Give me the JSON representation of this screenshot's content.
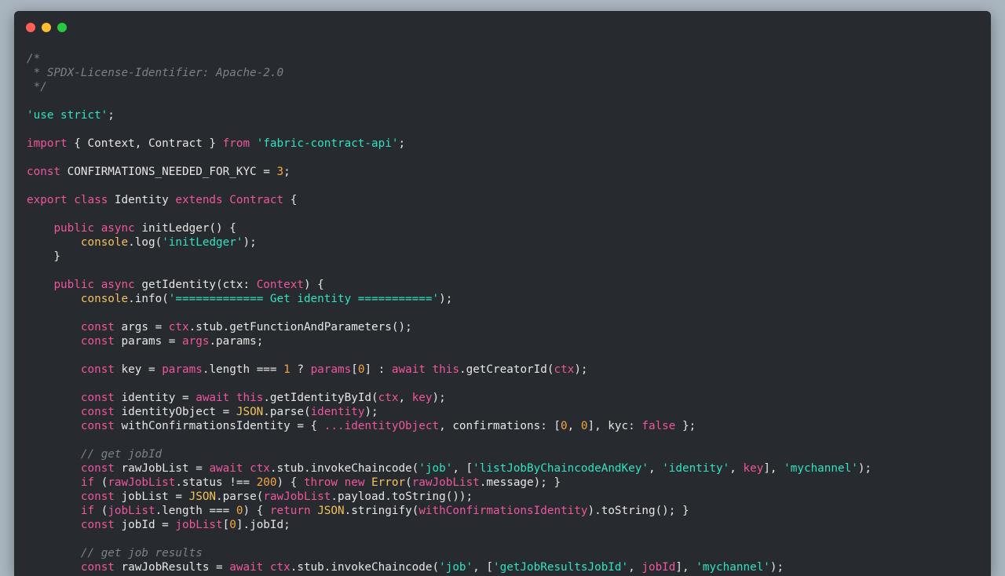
{
  "window": {
    "buttons": [
      {
        "name": "close",
        "color": "#ff5f57"
      },
      {
        "name": "minimize",
        "color": "#febc2e"
      },
      {
        "name": "maximize",
        "color": "#28c840"
      }
    ]
  },
  "theme": {
    "background": "#272a2f",
    "comment": "#7d8288",
    "keyword": "#f0569b",
    "string": "#2fe3c2",
    "number": "#f5a742",
    "builtin": "#f5c15a",
    "plain": "#e6e6e6"
  },
  "code": {
    "language": "typescript",
    "lines": [
      [
        [
          "cm",
          "/*"
        ]
      ],
      [
        [
          "cm",
          " * SPDX-License-Identifier: Apache-2.0"
        ]
      ],
      [
        [
          "cm",
          " */"
        ]
      ],
      [],
      [
        [
          "st",
          "'use strict'"
        ],
        [
          "pl",
          ";"
        ]
      ],
      [],
      [
        [
          "kw",
          "import"
        ],
        [
          "pl",
          " { Context, Contract } "
        ],
        [
          "kw",
          "from"
        ],
        [
          "pl",
          " "
        ],
        [
          "st",
          "'fabric-contract-api'"
        ],
        [
          "pl",
          ";"
        ]
      ],
      [],
      [
        [
          "kw",
          "const"
        ],
        [
          "pl",
          " CONFIRMATIONS_NEEDED_FOR_KYC = "
        ],
        [
          "nu",
          "3"
        ],
        [
          "pl",
          ";"
        ]
      ],
      [],
      [
        [
          "kw",
          "export"
        ],
        [
          "pl",
          " "
        ],
        [
          "kw",
          "class"
        ],
        [
          "pl",
          " Identity "
        ],
        [
          "kw",
          "extends"
        ],
        [
          "pl",
          " "
        ],
        [
          "kw",
          "Contract"
        ],
        [
          "pl",
          " {"
        ]
      ],
      [],
      [
        [
          "pl",
          "    "
        ],
        [
          "kw",
          "public"
        ],
        [
          "pl",
          " "
        ],
        [
          "kw",
          "async"
        ],
        [
          "pl",
          " initLedger() {"
        ]
      ],
      [
        [
          "pl",
          "        "
        ],
        [
          "bi",
          "console"
        ],
        [
          "pl",
          ".log("
        ],
        [
          "st",
          "'initLedger'"
        ],
        [
          "pl",
          ");"
        ]
      ],
      [
        [
          "pl",
          "    }"
        ]
      ],
      [],
      [
        [
          "pl",
          "    "
        ],
        [
          "kw",
          "public"
        ],
        [
          "pl",
          " "
        ],
        [
          "kw",
          "async"
        ],
        [
          "pl",
          " getIdentity(ctx: "
        ],
        [
          "kw",
          "Context"
        ],
        [
          "pl",
          ") {"
        ]
      ],
      [
        [
          "pl",
          "        "
        ],
        [
          "bi",
          "console"
        ],
        [
          "pl",
          ".info("
        ],
        [
          "st",
          "'============= Get identity ==========='"
        ],
        [
          "pl",
          ");"
        ]
      ],
      [],
      [
        [
          "pl",
          "        "
        ],
        [
          "kw",
          "const"
        ],
        [
          "pl",
          " args = "
        ],
        [
          "vr",
          "ctx"
        ],
        [
          "pl",
          ".stub.getFunctionAndParameters();"
        ]
      ],
      [
        [
          "pl",
          "        "
        ],
        [
          "kw",
          "const"
        ],
        [
          "pl",
          " params = "
        ],
        [
          "vr",
          "args"
        ],
        [
          "pl",
          ".params;"
        ]
      ],
      [],
      [
        [
          "pl",
          "        "
        ],
        [
          "kw",
          "const"
        ],
        [
          "pl",
          " key = "
        ],
        [
          "vr",
          "params"
        ],
        [
          "pl",
          ".length === "
        ],
        [
          "nu",
          "1"
        ],
        [
          "pl",
          " ? "
        ],
        [
          "vr",
          "params"
        ],
        [
          "pl",
          "["
        ],
        [
          "nu",
          "0"
        ],
        [
          "pl",
          "] : "
        ],
        [
          "kw",
          "await"
        ],
        [
          "pl",
          " "
        ],
        [
          "kw",
          "this"
        ],
        [
          "pl",
          ".getCreatorId("
        ],
        [
          "vr",
          "ctx"
        ],
        [
          "pl",
          ");"
        ]
      ],
      [],
      [
        [
          "pl",
          "        "
        ],
        [
          "kw",
          "const"
        ],
        [
          "pl",
          " identity = "
        ],
        [
          "kw",
          "await"
        ],
        [
          "pl",
          " "
        ],
        [
          "kw",
          "this"
        ],
        [
          "pl",
          ".getIdentityById("
        ],
        [
          "vr",
          "ctx"
        ],
        [
          "pl",
          ", "
        ],
        [
          "vr",
          "key"
        ],
        [
          "pl",
          ");"
        ]
      ],
      [
        [
          "pl",
          "        "
        ],
        [
          "kw",
          "const"
        ],
        [
          "pl",
          " identityObject = "
        ],
        [
          "bi",
          "JSON"
        ],
        [
          "pl",
          ".parse("
        ],
        [
          "vr",
          "identity"
        ],
        [
          "pl",
          ");"
        ]
      ],
      [
        [
          "pl",
          "        "
        ],
        [
          "kw",
          "const"
        ],
        [
          "pl",
          " withConfirmationsIdentity = { "
        ],
        [
          "vr",
          "..."
        ],
        [
          "vr",
          "identityObject"
        ],
        [
          "pl",
          ", confirmations: ["
        ],
        [
          "nu",
          "0"
        ],
        [
          "pl",
          ", "
        ],
        [
          "nu",
          "0"
        ],
        [
          "pl",
          "], kyc: "
        ],
        [
          "kw",
          "false"
        ],
        [
          "pl",
          " };"
        ]
      ],
      [],
      [
        [
          "pl",
          "        "
        ],
        [
          "cm",
          "// get jobId"
        ]
      ],
      [
        [
          "pl",
          "        "
        ],
        [
          "kw",
          "const"
        ],
        [
          "pl",
          " rawJobList = "
        ],
        [
          "kw",
          "await"
        ],
        [
          "pl",
          " "
        ],
        [
          "vr",
          "ctx"
        ],
        [
          "pl",
          ".stub.invokeChaincode("
        ],
        [
          "st",
          "'job'"
        ],
        [
          "pl",
          ", ["
        ],
        [
          "st",
          "'listJobByChaincodeAndKey'"
        ],
        [
          "pl",
          ", "
        ],
        [
          "st",
          "'identity'"
        ],
        [
          "pl",
          ", "
        ],
        [
          "vr",
          "key"
        ],
        [
          "pl",
          "], "
        ],
        [
          "st",
          "'mychannel'"
        ],
        [
          "pl",
          ");"
        ]
      ],
      [
        [
          "pl",
          "        "
        ],
        [
          "kw",
          "if"
        ],
        [
          "pl",
          " ("
        ],
        [
          "vr",
          "rawJobList"
        ],
        [
          "pl",
          ".status !== "
        ],
        [
          "nu",
          "200"
        ],
        [
          "pl",
          ") { "
        ],
        [
          "kw",
          "throw"
        ],
        [
          "pl",
          " "
        ],
        [
          "kw",
          "new"
        ],
        [
          "pl",
          " "
        ],
        [
          "bi",
          "Error"
        ],
        [
          "pl",
          "("
        ],
        [
          "vr",
          "rawJobList"
        ],
        [
          "pl",
          ".message); }"
        ]
      ],
      [
        [
          "pl",
          "        "
        ],
        [
          "kw",
          "const"
        ],
        [
          "pl",
          " jobList = "
        ],
        [
          "bi",
          "JSON"
        ],
        [
          "pl",
          ".parse("
        ],
        [
          "vr",
          "rawJobList"
        ],
        [
          "pl",
          ".payload.toString());"
        ]
      ],
      [
        [
          "pl",
          "        "
        ],
        [
          "kw",
          "if"
        ],
        [
          "pl",
          " ("
        ],
        [
          "vr",
          "jobList"
        ],
        [
          "pl",
          ".length === "
        ],
        [
          "nu",
          "0"
        ],
        [
          "pl",
          ") { "
        ],
        [
          "kw",
          "return"
        ],
        [
          "pl",
          " "
        ],
        [
          "bi",
          "JSON"
        ],
        [
          "pl",
          ".stringify("
        ],
        [
          "vr",
          "withConfirmationsIdentity"
        ],
        [
          "pl",
          ").toString(); }"
        ]
      ],
      [
        [
          "pl",
          "        "
        ],
        [
          "kw",
          "const"
        ],
        [
          "pl",
          " jobId = "
        ],
        [
          "vr",
          "jobList"
        ],
        [
          "pl",
          "["
        ],
        [
          "nu",
          "0"
        ],
        [
          "pl",
          "].jobId;"
        ]
      ],
      [],
      [
        [
          "pl",
          "        "
        ],
        [
          "cm",
          "// get job results"
        ]
      ],
      [
        [
          "pl",
          "        "
        ],
        [
          "kw",
          "const"
        ],
        [
          "pl",
          " rawJobResults = "
        ],
        [
          "kw",
          "await"
        ],
        [
          "pl",
          " "
        ],
        [
          "vr",
          "ctx"
        ],
        [
          "pl",
          ".stub.invokeChaincode("
        ],
        [
          "st",
          "'job'"
        ],
        [
          "pl",
          ", ["
        ],
        [
          "st",
          "'getJobResultsJobId'"
        ],
        [
          "pl",
          ", "
        ],
        [
          "vr",
          "jobId"
        ],
        [
          "pl",
          "], "
        ],
        [
          "st",
          "'mychannel'"
        ],
        [
          "pl",
          ");"
        ]
      ]
    ]
  }
}
